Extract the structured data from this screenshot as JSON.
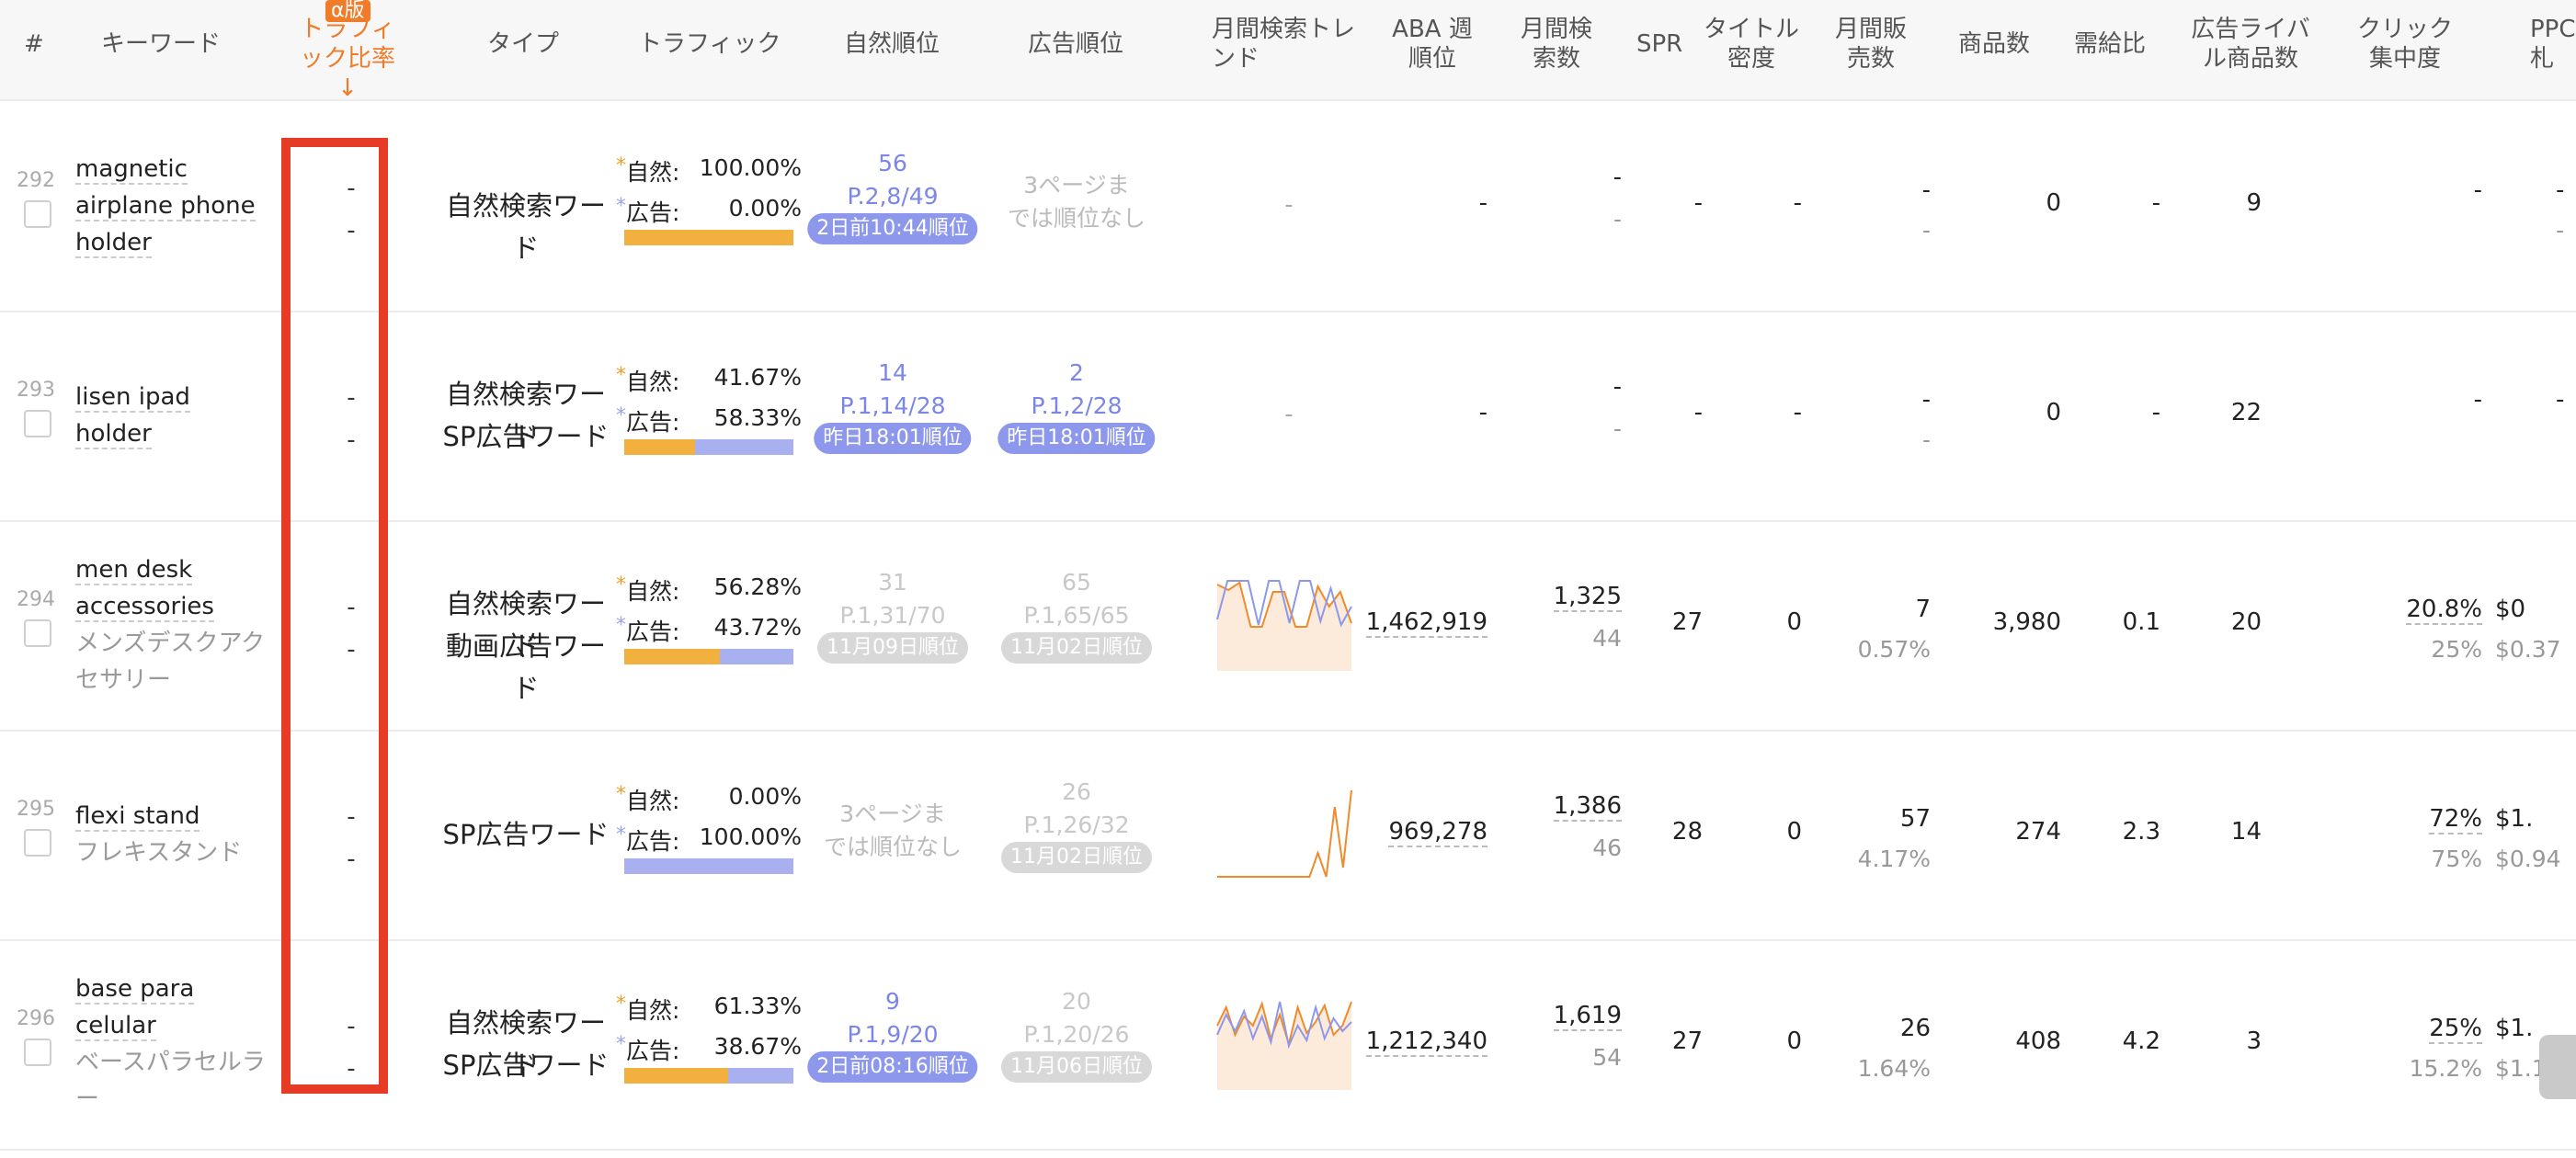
{
  "header": {
    "hash": "#",
    "keyword": "キーワード",
    "alpha_badge": "α版",
    "traffic_ratio": "トラフィ ック比率↓",
    "type": "タイプ",
    "traffic": "トラフィック",
    "organic_rank": "自然順位",
    "ad_rank": "広告順位",
    "monthly_trend": "月間検索トレ ンド",
    "aba": "ABA 週順位",
    "monthly_search": "月間検 索数",
    "spr": "SPR",
    "title_density": "タイトル 密度",
    "monthly_sales": "月間販 売数",
    "products": "商品数",
    "supply_demand": "需給比",
    "ad_rivals": "広告ライバ ル商品数",
    "click_concentration": "クリック 集中度",
    "ppc": "PPC 札",
    "colors": {
      "accent_orange": "#f07c2a",
      "highlight_red": "#e63c26",
      "organic_bar": "#f2b03f",
      "ad_bar": "#a9b0ef",
      "pill_blue": "#8d98ec"
    }
  },
  "labels": {
    "organic": "自然:",
    "ad": "広告:",
    "star": "*"
  },
  "rows": [
    {
      "num": "292",
      "kw_lines": [
        "magnetic",
        "airplane phone",
        "holder"
      ],
      "kw_jp": [],
      "ratio": [
        "-",
        "-"
      ],
      "types": [
        "自然検索ワード"
      ],
      "organic_pct": "100.00%",
      "ad_pct": "0.00%",
      "organic_share": 1.0,
      "organic_rank": [
        "56",
        "P.2,8/49"
      ],
      "organic_pill": "2日前10:44順位",
      "organic_style": "blue",
      "ad_rank": [
        "3ページま",
        "では順位なし"
      ],
      "ad_pill": "",
      "ad_style": "mid",
      "trend": "-",
      "aba": "-",
      "search": "-",
      "search2": "-",
      "spr": "-",
      "density": "-",
      "sales": "-",
      "sales2": "-",
      "products": "0",
      "sd": "-",
      "rivals": "9",
      "click": "-",
      "click2": "",
      "ppc": "-",
      "ppc2": "-"
    },
    {
      "num": "293",
      "kw_lines": [
        "lisen ipad",
        "holder"
      ],
      "kw_jp": [],
      "ratio": [
        "-",
        "-"
      ],
      "types": [
        "自然検索ワード",
        "SP広告ワード"
      ],
      "organic_pct": "41.67%",
      "ad_pct": "58.33%",
      "organic_share": 0.4167,
      "organic_rank": [
        "14",
        "P.1,14/28"
      ],
      "organic_pill": "昨日18:01順位",
      "organic_style": "blue",
      "ad_rank": [
        "2",
        "P.1,2/28"
      ],
      "ad_pill": "昨日18:01順位",
      "ad_style": "blue",
      "trend": "-",
      "aba": "-",
      "search": "-",
      "search2": "-",
      "spr": "-",
      "density": "-",
      "sales": "-",
      "sales2": "-",
      "products": "0",
      "sd": "-",
      "rivals": "22",
      "click": "-",
      "click2": "",
      "ppc": "-",
      "ppc2": ""
    },
    {
      "num": "294",
      "kw_lines": [
        "men desk",
        "accessories"
      ],
      "kw_jp": [
        "メンズデスクアク",
        "セサリー"
      ],
      "ratio": [
        "-",
        "-"
      ],
      "types": [
        "自然検索ワード",
        "動画広告ワード"
      ],
      "organic_pct": "56.28%",
      "ad_pct": "43.72%",
      "organic_share": 0.5628,
      "organic_rank": [
        "31",
        "P.1,31/70"
      ],
      "organic_pill": "11月09日順位",
      "organic_style": "gray",
      "ad_rank": [
        "65",
        "P.1,65/65"
      ],
      "ad_pill": "11月02日順位",
      "ad_style": "gray",
      "trend": "spark1",
      "aba": "1,462,919",
      "search": "1,325",
      "search2": "44",
      "spr": "27",
      "density": "0",
      "sales": "7",
      "sales2": "0.57%",
      "products": "3,980",
      "sd": "0.1",
      "rivals": "20",
      "click": "20.8%",
      "click2": "25%",
      "ppc": "$0",
      "ppc2": "$0.37"
    },
    {
      "num": "295",
      "kw_lines": [
        "flexi stand"
      ],
      "kw_jp": [
        "フレキスタンド"
      ],
      "ratio": [
        "-",
        "-"
      ],
      "types": [
        "SP広告ワード"
      ],
      "organic_pct": "0.00%",
      "ad_pct": "100.00%",
      "organic_share": 0.0,
      "organic_rank": [
        "3ページま",
        "では順位なし"
      ],
      "organic_pill": "",
      "organic_style": "mid",
      "ad_rank": [
        "26",
        "P.1,26/32"
      ],
      "ad_pill": "11月02日順位",
      "ad_style": "gray",
      "trend": "spark2",
      "aba": "969,278",
      "search": "1,386",
      "search2": "46",
      "spr": "28",
      "density": "0",
      "sales": "57",
      "sales2": "4.17%",
      "products": "274",
      "sd": "2.3",
      "rivals": "14",
      "click": "72%",
      "click2": "75%",
      "ppc": "$1.",
      "ppc2": "$0.94"
    },
    {
      "num": "296",
      "kw_lines": [
        "base para",
        "celular"
      ],
      "kw_jp": [
        "ベースパラセルラ",
        "ー"
      ],
      "ratio": [
        "-",
        "-"
      ],
      "types": [
        "自然検索ワード",
        "SP広告ワード"
      ],
      "organic_pct": "61.33%",
      "ad_pct": "38.67%",
      "organic_share": 0.6133,
      "organic_rank": [
        "9",
        "P.1,9/20"
      ],
      "organic_pill": "2日前08:16順位",
      "organic_style": "blue",
      "ad_rank": [
        "20",
        "P.1,20/26"
      ],
      "ad_pill": "11月06日順位",
      "ad_style": "gray",
      "trend": "spark3",
      "aba": "1,212,340",
      "search": "1,619",
      "search2": "54",
      "spr": "27",
      "density": "0",
      "sales": "26",
      "sales2": "1.64%",
      "products": "408",
      "sd": "4.2",
      "rivals": "3",
      "click": "25%",
      "click2": "15.2%",
      "ppc": "$1.",
      "ppc2": "$1.1"
    }
  ]
}
